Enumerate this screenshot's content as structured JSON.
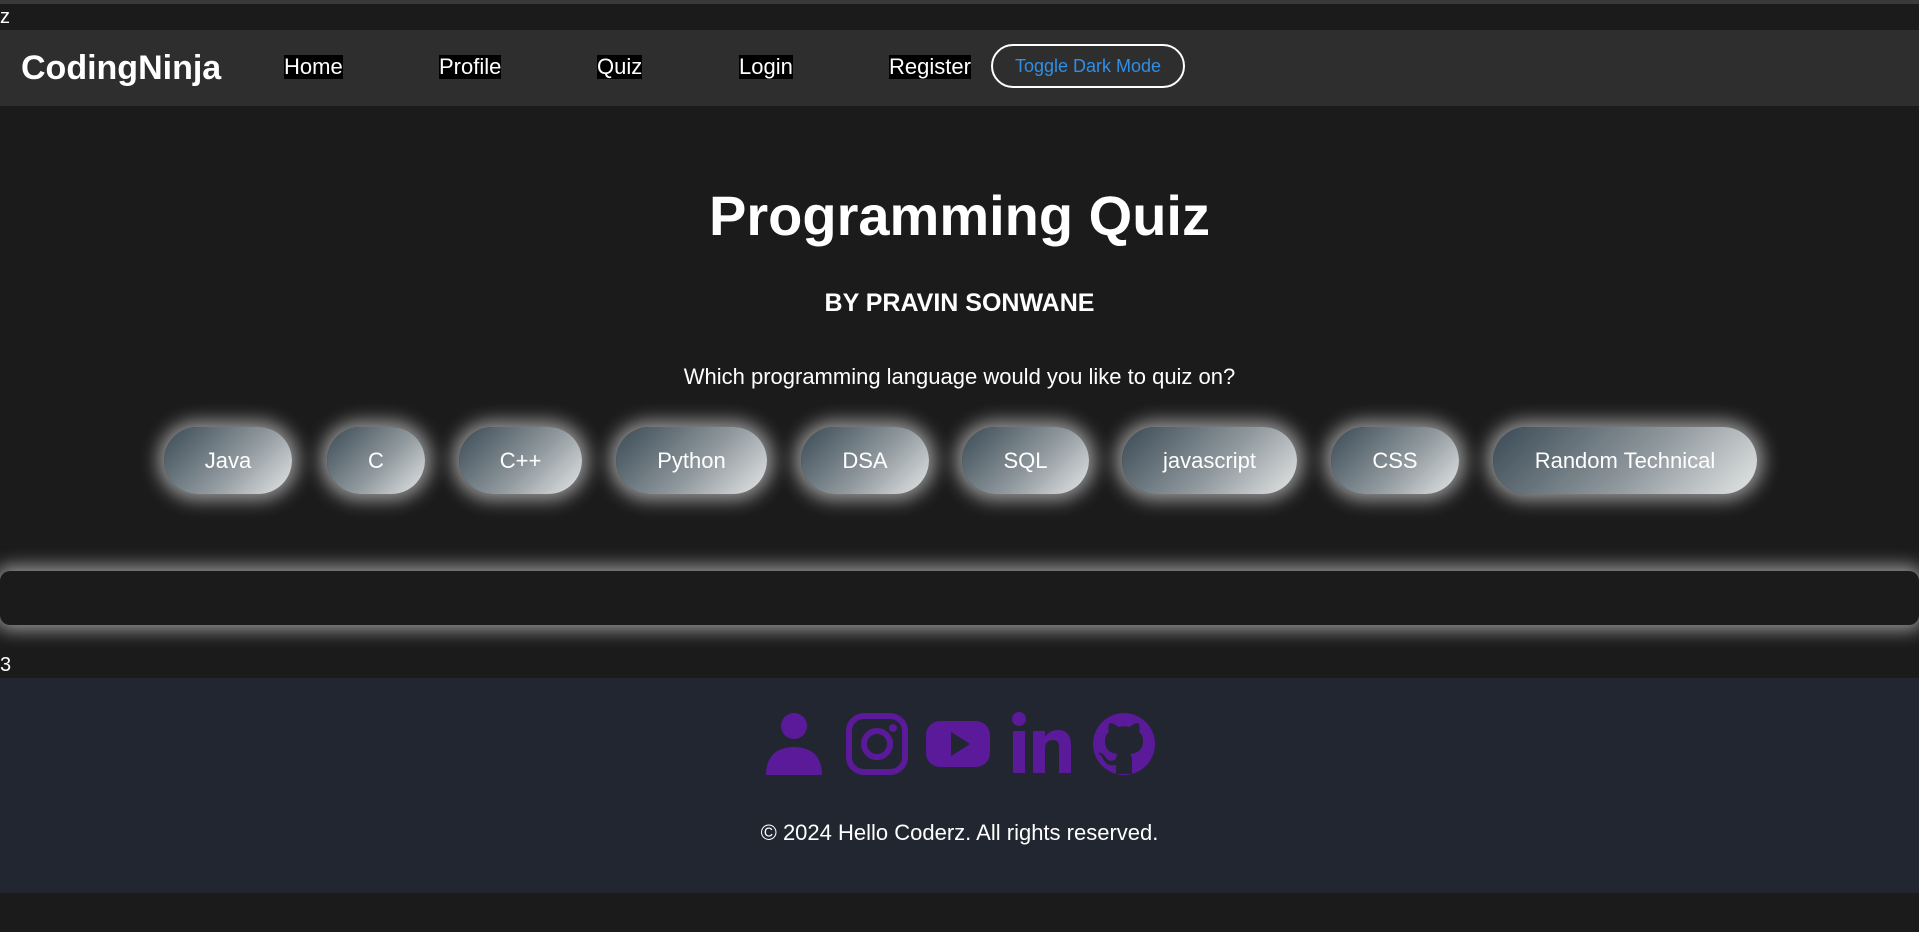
{
  "stray_top_text": "z",
  "navbar": {
    "brand": "CodingNinja",
    "links": [
      "Home",
      "Profile",
      "Quiz",
      "Login",
      "Register"
    ],
    "toggle_label": "Toggle Dark Mode"
  },
  "main": {
    "title": "Programming Quiz",
    "author": "BY PRAVIN SONWANE",
    "prompt": "Which programming language would you like to quiz on?",
    "languages": [
      "Java",
      "C",
      "C++",
      "Python",
      "DSA",
      "SQL",
      "javascript",
      "CSS",
      "Random Technical"
    ]
  },
  "stray_bottom_text": "3",
  "footer": {
    "icons": [
      "user-icon",
      "instagram-icon",
      "youtube-icon",
      "linkedin-icon",
      "github-icon"
    ],
    "icon_color": "#5a1a9a",
    "copyright": "© 2024 Hello Coderz. All rights reserved."
  },
  "colors": {
    "background": "#1b1b1b",
    "navbar": "#2e2e2e",
    "footer": "#212630",
    "toggle_text": "#2f8fe6"
  }
}
